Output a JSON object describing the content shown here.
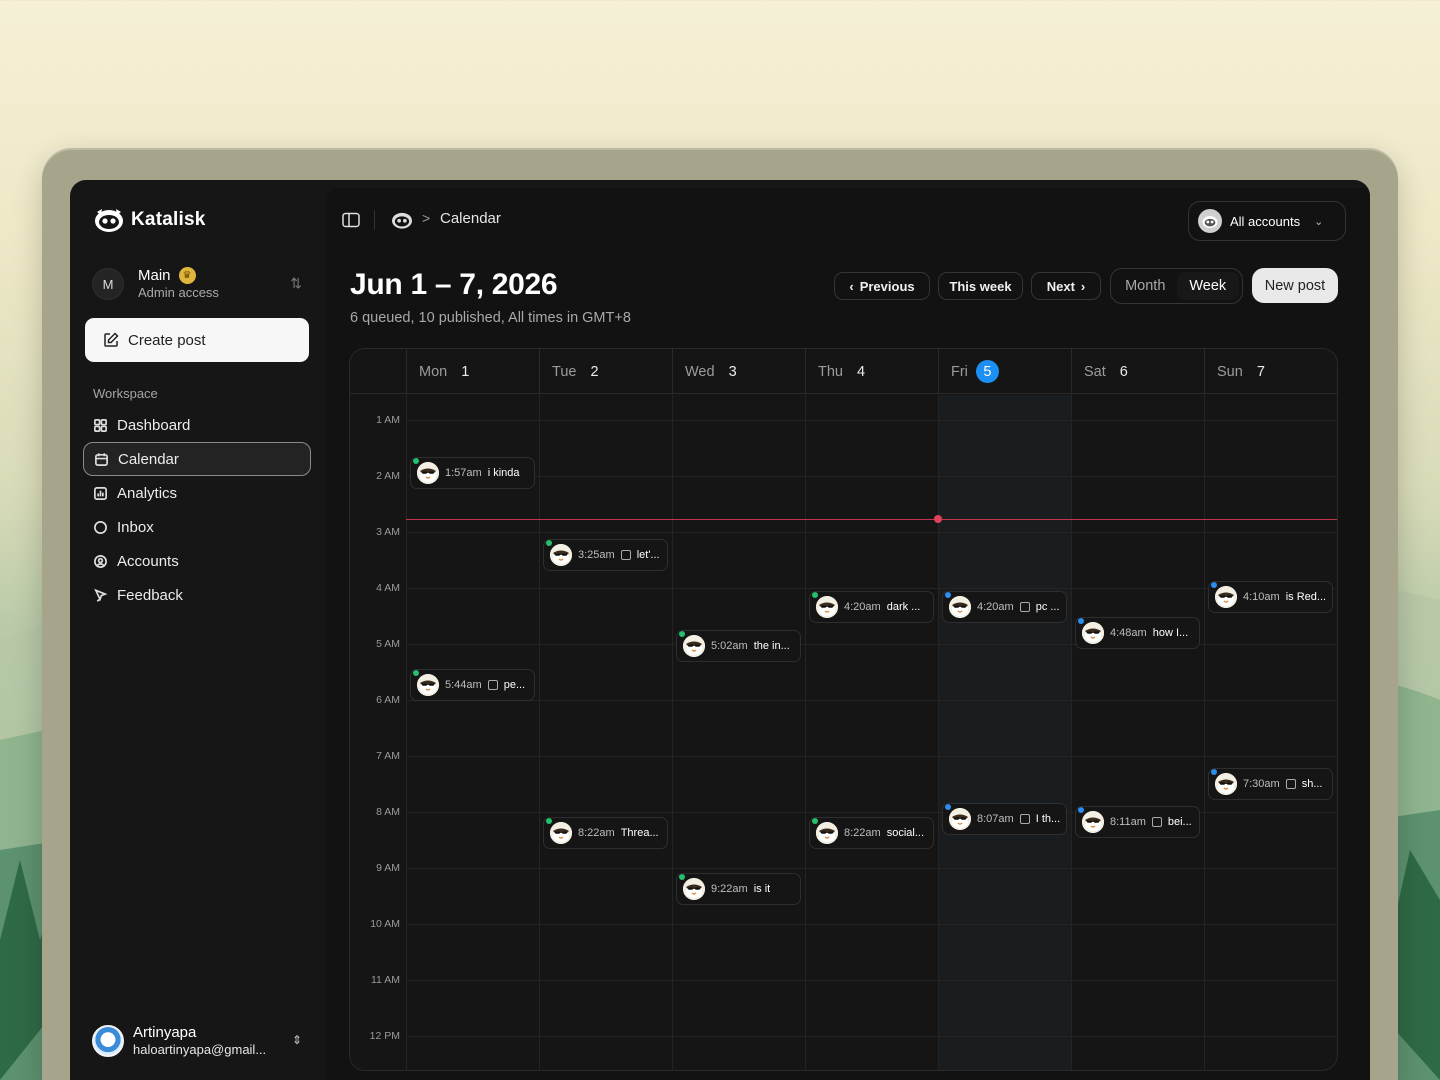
{
  "brand": {
    "name": "Katalisk"
  },
  "workspace": {
    "initial": "M",
    "name": "Main",
    "role": "Admin access"
  },
  "sidebar": {
    "create_label": "Create post",
    "section_label": "Workspace",
    "items": [
      {
        "label": "Dashboard",
        "icon": "dashboard-icon"
      },
      {
        "label": "Calendar",
        "icon": "calendar-icon",
        "active": true
      },
      {
        "label": "Analytics",
        "icon": "analytics-icon"
      },
      {
        "label": "Inbox",
        "icon": "inbox-icon"
      },
      {
        "label": "Accounts",
        "icon": "accounts-icon"
      },
      {
        "label": "Feedback",
        "icon": "feedback-icon"
      }
    ]
  },
  "user": {
    "name": "Artinyapa",
    "email": "haloartinyapa@gmail..."
  },
  "breadcrumb": {
    "separator": ">",
    "title": "Calendar"
  },
  "accounts_filter": {
    "label": "All accounts"
  },
  "header": {
    "title": "Jun 1 – 7, 2026",
    "subtitle": "6 queued, 10 published, All times in GMT+8"
  },
  "toolbar": {
    "previous": "Previous",
    "this_week": "This week",
    "next": "Next",
    "view_month": "Month",
    "view_week": "Week",
    "new_post": "New post"
  },
  "calendar": {
    "days": [
      {
        "name": "Mon",
        "num": "1"
      },
      {
        "name": "Tue",
        "num": "2"
      },
      {
        "name": "Wed",
        "num": "3"
      },
      {
        "name": "Thu",
        "num": "4"
      },
      {
        "name": "Fri",
        "num": "5",
        "today": true
      },
      {
        "name": "Sat",
        "num": "6"
      },
      {
        "name": "Sun",
        "num": "7"
      }
    ],
    "hours": [
      "1 AM",
      "2 AM",
      "3 AM",
      "4 AM",
      "5 AM",
      "6 AM",
      "7 AM",
      "8 AM",
      "9 AM",
      "10 AM",
      "11 AM",
      "12 PM"
    ],
    "events": [
      {
        "day": 0,
        "time": "1:57am",
        "text": "i kinda",
        "media": false,
        "status": "green"
      },
      {
        "day": 1,
        "time": "3:25am",
        "text": "let'...",
        "media": true,
        "status": "green"
      },
      {
        "day": 3,
        "time": "4:20am",
        "text": "dark ...",
        "media": false,
        "status": "green"
      },
      {
        "day": 4,
        "time": "4:20am",
        "text": "pc ...",
        "media": true,
        "status": "blue"
      },
      {
        "day": 6,
        "time": "4:10am",
        "text": "is Red...",
        "media": false,
        "status": "blue"
      },
      {
        "day": 5,
        "time": "4:48am",
        "text": "how I...",
        "media": false,
        "status": "blue"
      },
      {
        "day": 2,
        "time": "5:02am",
        "text": "the in...",
        "media": false,
        "status": "green"
      },
      {
        "day": 0,
        "time": "5:44am",
        "text": "pe...",
        "media": true,
        "status": "green"
      },
      {
        "day": 6,
        "time": "7:30am",
        "text": "sh...",
        "media": true,
        "status": "blue"
      },
      {
        "day": 4,
        "time": "8:07am",
        "text": "I th...",
        "media": true,
        "status": "blue"
      },
      {
        "day": 5,
        "time": "8:11am",
        "text": "bei...",
        "media": true,
        "status": "blue"
      },
      {
        "day": 1,
        "time": "8:22am",
        "text": "Threa...",
        "media": false,
        "status": "green"
      },
      {
        "day": 3,
        "time": "8:22am",
        "text": "social...",
        "media": false,
        "status": "green"
      },
      {
        "day": 2,
        "time": "9:22am",
        "text": "is it",
        "media": false,
        "status": "green"
      }
    ],
    "now_time": "2:46am"
  }
}
